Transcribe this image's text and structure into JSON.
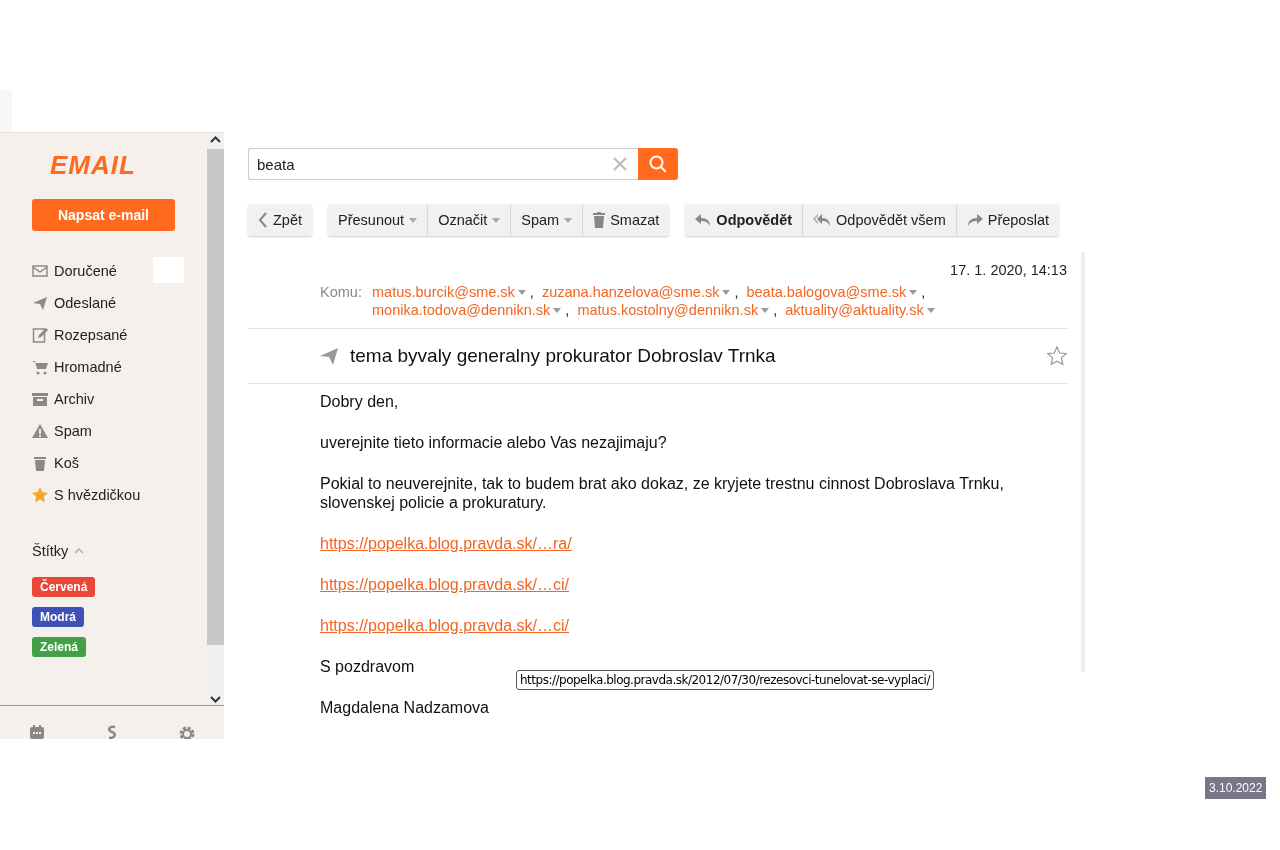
{
  "sidebar": {
    "logo": "EMAIL",
    "compose_button": "Napsat e-mail",
    "folders": [
      {
        "kind": "mail",
        "label": "Doručené",
        "badge": true
      },
      {
        "kind": "send",
        "label": "Odeslané",
        "badge": false
      },
      {
        "kind": "draft",
        "label": "Rozepsané",
        "badge": false
      },
      {
        "kind": "cart",
        "label": "Hromadné",
        "badge": false
      },
      {
        "kind": "archive",
        "label": "Archiv",
        "badge": false
      },
      {
        "kind": "warning",
        "label": "Spam",
        "badge": false
      },
      {
        "kind": "trash",
        "label": "Koš",
        "badge": false
      },
      {
        "kind": "star",
        "label": "S hvězdičkou",
        "badge": false
      }
    ],
    "labels_heading": "Štítky",
    "labels_expanded": true,
    "labels": [
      {
        "label": "Červená",
        "color": "#e8473a"
      },
      {
        "label": "Modrá",
        "color": "#3f51b5"
      },
      {
        "label": "Zelená",
        "color": "#43a047"
      }
    ]
  },
  "search": {
    "value": "beata"
  },
  "toolbar": [
    [
      {
        "label": "Zpět",
        "kind": "back",
        "bold": false
      }
    ],
    [
      {
        "label": "Přesunout",
        "kind": "dropdown",
        "bold": false
      },
      {
        "label": "Označit",
        "kind": "dropdown",
        "bold": false
      },
      {
        "label": "Spam",
        "kind": "dropdown",
        "bold": false
      },
      {
        "label": "Smazat",
        "kind": "trash",
        "bold": false
      }
    ],
    [
      {
        "label": "Odpovědět",
        "kind": "reply",
        "bold": true
      },
      {
        "label": "Odpovědět všem",
        "kind": "replyall",
        "bold": false
      },
      {
        "label": "Přeposlat",
        "kind": "forward",
        "bold": false
      }
    ]
  ],
  "message": {
    "date": "17. 1. 2020, 14:13",
    "to_label": "Komu:",
    "recipients": [
      [
        {
          "email": "matus.burcik@sme.sk",
          "trailing": ","
        },
        {
          "email": "zuzana.hanzelova@sme.sk",
          "trailing": ","
        },
        {
          "email": "beata.balogova@sme.sk",
          "trailing": ","
        }
      ],
      [
        {
          "email": "monika.todova@dennikn.sk",
          "trailing": ","
        },
        {
          "email": "matus.kostolny@dennikn.sk",
          "trailing": ","
        },
        {
          "email": "aktuality@aktuality.sk"
        }
      ]
    ],
    "subject": "tema byvaly generalny prokurator Dobroslav Trnka",
    "starred": false,
    "body": [
      {
        "kind": "text",
        "text": "Dobry den,"
      },
      {
        "kind": "text",
        "text": "uverejnite tieto informacie alebo Vas nezajimaju?"
      },
      {
        "kind": "text",
        "text": "Pokial to neuverejnite, tak to budem brat ako dokaz, ze kryjete trestnu cinnost Dobroslava Trnku, slovenskej policie a prokuratury."
      },
      {
        "kind": "link",
        "text": "https://popelka.blog.pravda.sk/…ra/"
      },
      {
        "kind": "link",
        "text": "https://popelka.blog.pravda.sk/…ci/"
      },
      {
        "kind": "link",
        "text": "https://popelka.blog.pravda.sk/…ci/"
      },
      {
        "kind": "text",
        "text": "S pozdravom"
      },
      {
        "kind": "text",
        "text": "Magdalena Nadzamova"
      }
    ],
    "tooltip": "https://popelka.blog.pravda.sk/2012/07/30/rezesovci-tunelovat-se-vyplaci/"
  },
  "date_stamp": "3.10.2022"
}
